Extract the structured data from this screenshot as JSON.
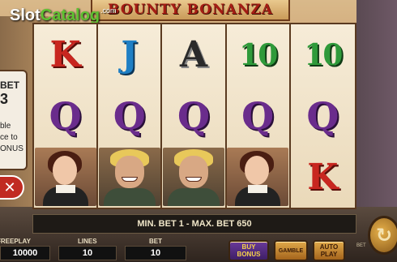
{
  "logo": {
    "text_part1": "Slot",
    "text_part2": "Catalog",
    "suffix": ".com"
  },
  "title": "BOUNTY BONANZA",
  "reels": [
    [
      "K",
      "Q",
      "woman"
    ],
    [
      "J",
      "Q",
      "man"
    ],
    [
      "A",
      "Q",
      "man"
    ],
    [
      "10",
      "Q",
      "woman"
    ],
    [
      "10",
      "Q",
      "K"
    ]
  ],
  "info_panel": {
    "line1": "BET",
    "line2": "3",
    "line3": "ble",
    "line4": "ce to",
    "line5": "ONUS"
  },
  "close_label": "✕",
  "bet_info": "MIN. BET 1 - MAX. BET 650",
  "controls": {
    "freeplay_label": "FREEPLAY",
    "freeplay_value": "10000",
    "lines_label": "LINES",
    "lines_value": "10",
    "bet_label": "BET",
    "bet_value": "10",
    "buy_bonus_line1": "BUY",
    "buy_bonus_line2": "BONUS",
    "gamble_label": "GAMBLE",
    "auto_line1": "AUTO",
    "auto_line2": "PLAY",
    "bet_mini": "BET"
  },
  "icons": {
    "spin": "refresh-arrow-icon",
    "close": "close-icon"
  },
  "colors": {
    "title": "#a51c14",
    "K": "#c8261f",
    "J": "#1f7fc4",
    "ten": "#2f9a3a",
    "Q": "#6a2c8c"
  }
}
